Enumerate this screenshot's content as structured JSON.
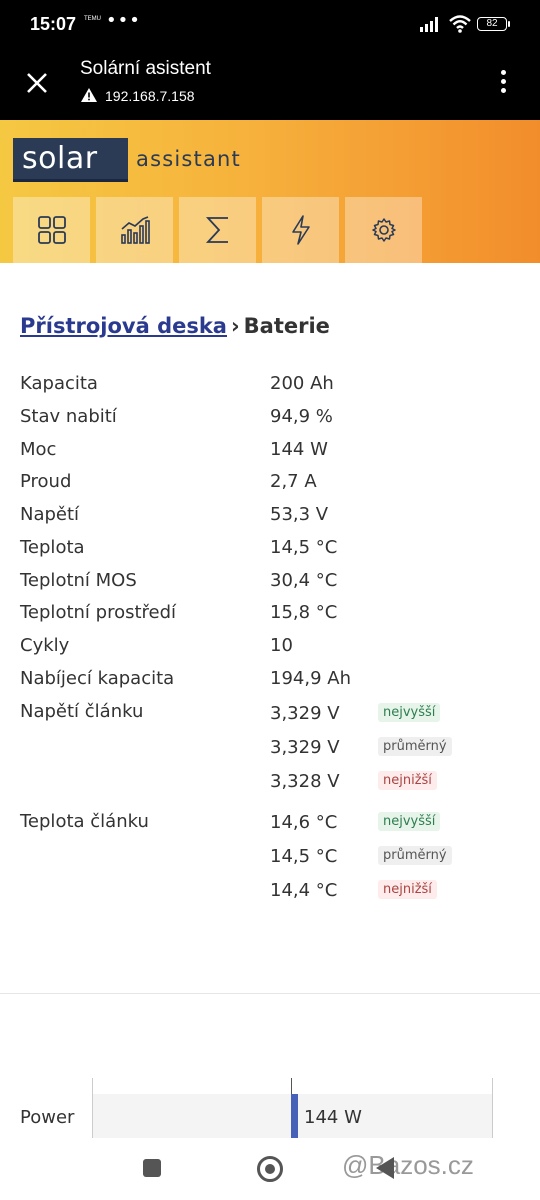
{
  "status": {
    "time": "15:07",
    "temu": "TEMU",
    "dots": "•••",
    "battery": "82"
  },
  "browser": {
    "title": "Solární asistent",
    "url": "192.168.7.158"
  },
  "logo": {
    "brand": "solar",
    "suffix": "assistant"
  },
  "nav_tiles": [
    "dashboard-icon",
    "chart-icon",
    "sum-icon",
    "lightning-icon",
    "gear-icon"
  ],
  "breadcrumb": {
    "link": "Přístrojová deska",
    "sep": "›",
    "current": "Baterie"
  },
  "rows": [
    {
      "label": "Kapacita",
      "value": "200 Ah"
    },
    {
      "label": "Stav nabití",
      "value": "94,9 %"
    },
    {
      "label": "Moc",
      "value": "144 W"
    },
    {
      "label": "Proud",
      "value": "2,7 A"
    },
    {
      "label": "Napětí",
      "value": "53,3 V"
    },
    {
      "label": "Teplota",
      "value": "14,5 °C"
    },
    {
      "label": "Teplotní MOS",
      "value": "30,4 °C"
    },
    {
      "label": "Teplotní prostředí",
      "value": "15,8 °C"
    },
    {
      "label": "Cykly",
      "value": "10"
    },
    {
      "label": "Nabíjecí kapacita",
      "value": "194,9 Ah"
    }
  ],
  "cell_voltage": {
    "label": "Napětí článku",
    "values": [
      "3,329 V",
      "3,329 V",
      "3,328 V"
    ],
    "badges": [
      "nejvyšší",
      "průměrný",
      "nejnižší"
    ]
  },
  "cell_temp": {
    "label": "Teplota článku",
    "values": [
      "14,6 °C",
      "14,5 °C",
      "14,4 °C"
    ],
    "badges": [
      "nejvyšší",
      "průměrný",
      "nejnižší"
    ]
  },
  "power": {
    "label": "Power",
    "value": "144 W"
  },
  "watermark": "@Bazos.cz"
}
